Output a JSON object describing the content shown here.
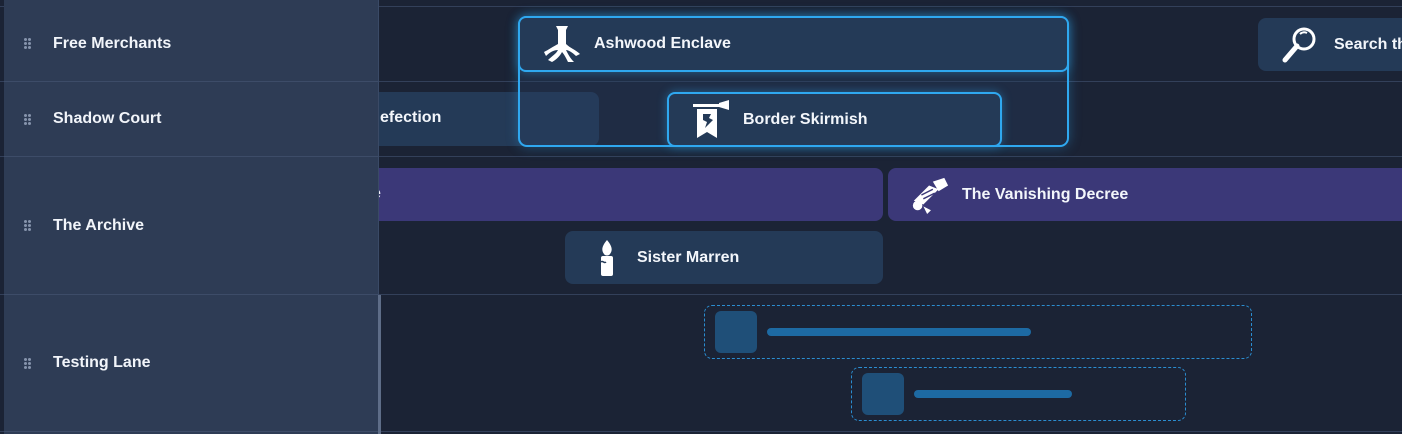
{
  "lanes": [
    {
      "label": "Free Merchants"
    },
    {
      "label": "Shadow Court"
    },
    {
      "label": "The Archive"
    },
    {
      "label": "Testing Lane"
    }
  ],
  "events": {
    "ashwood": {
      "title": "Ashwood Enclave",
      "icon": "tree-roots-icon"
    },
    "border": {
      "title": "Border Skirmish",
      "icon": "war-banner-icon"
    },
    "defection": {
      "title_fragment": "efection"
    },
    "archive_long": {
      "title_fragment": "e"
    },
    "decree": {
      "title": "The Vanishing Decree",
      "icon": "scroll-icon"
    },
    "marren": {
      "title": "Sister Marren",
      "icon": "candle-icon"
    },
    "search": {
      "title_fragment": "Search th",
      "icon": "magnifier-icon"
    }
  },
  "colors": {
    "accent": "#2fa8f0",
    "event_blue": "#243a57",
    "event_purple": "#3b3878",
    "sidebar": "#2e3c55",
    "background": "#1b2335"
  }
}
